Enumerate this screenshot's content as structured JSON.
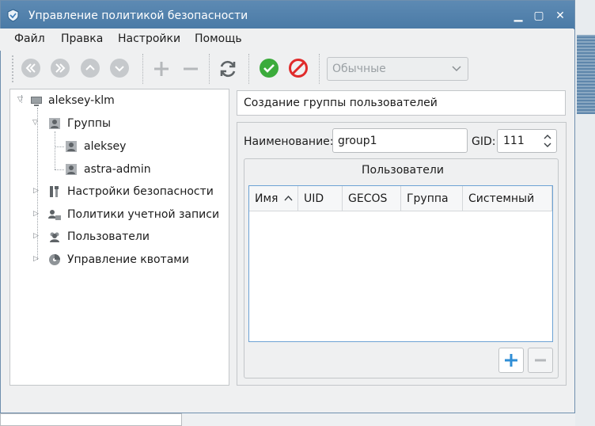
{
  "window": {
    "title": "Управление политикой безопасности"
  },
  "menu": {
    "file": "Файл",
    "edit": "Правка",
    "settings": "Настройки",
    "help": "Помощь"
  },
  "toolbar": {
    "combo_value": "Обычные"
  },
  "tree": {
    "root": "aleksey-klm",
    "groups": "Группы",
    "group_items": [
      "aleksey",
      "astra-admin"
    ],
    "security_settings": "Настройки безопасности",
    "account_policies": "Политики учетной записи",
    "users": "Пользователи",
    "quota_management": "Управление квотами"
  },
  "panel": {
    "header": "Создание группы пользователей",
    "name_label": "Наименование:",
    "name_value": "group1",
    "gid_label": "GID:",
    "gid_value": "111",
    "users_group_title": "Пользователи",
    "columns": [
      "Имя",
      "UID",
      "GECOS",
      "Группа",
      "Системный"
    ]
  },
  "colors": {
    "titlebar": "#4f7fab",
    "add_accent": "#2f8ed6",
    "ok_green": "#3bab3b",
    "cancel_red": "#e02b2b"
  }
}
